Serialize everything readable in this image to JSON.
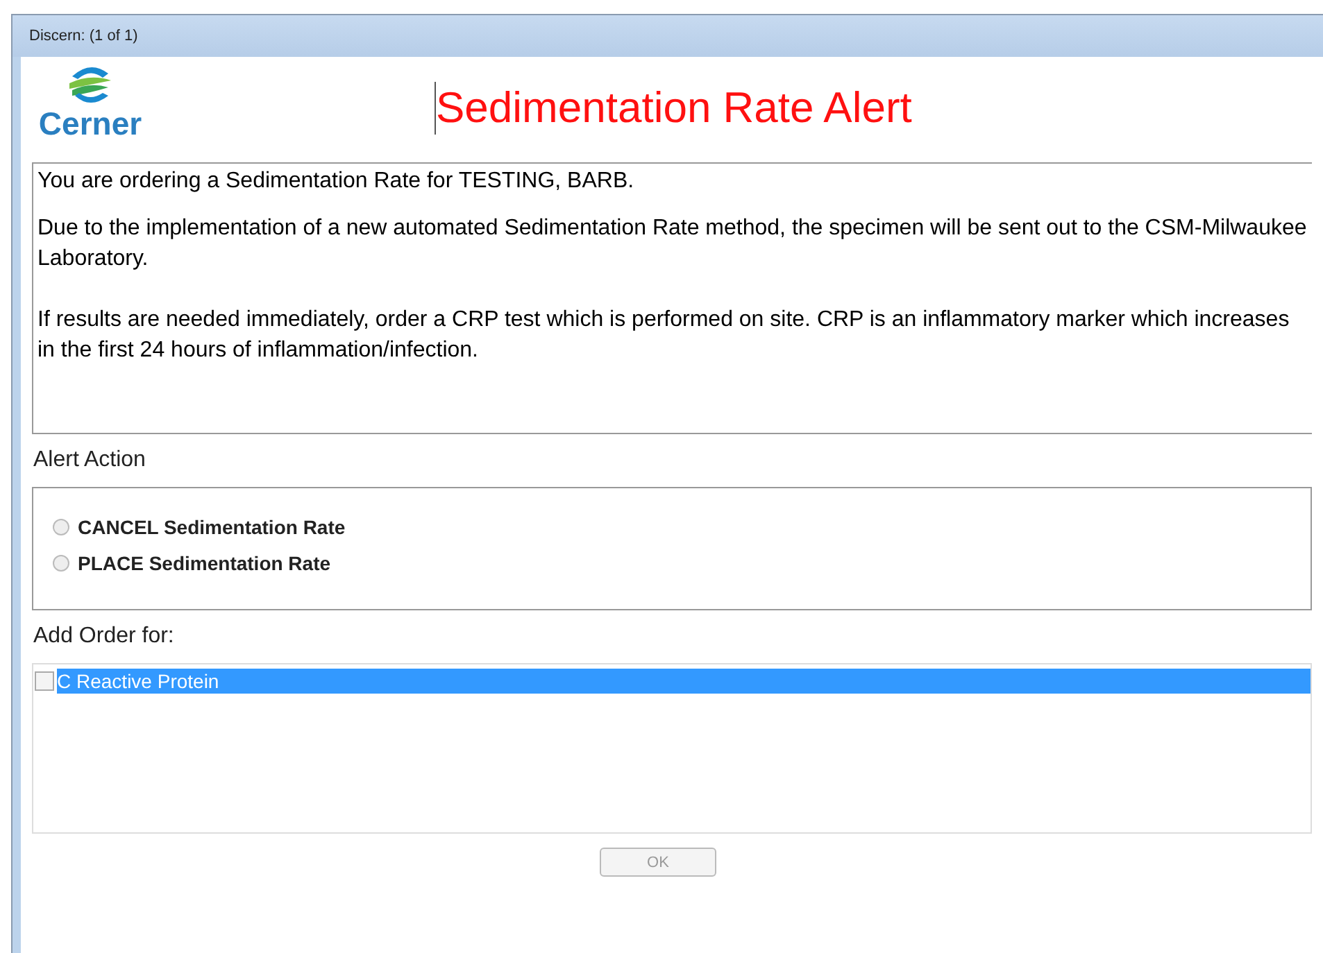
{
  "window": {
    "title": "Discern: (1 of 1)"
  },
  "logo": {
    "text": "Cerner"
  },
  "heading": "Sedimentation Rate Alert",
  "message": [
    "You are ordering a Sedimentation Rate for TESTING, BARB.",
    "Due to the implementation of a new automated Sedimentation Rate method, the specimen will be sent out to the CSM-Milwaukee Laboratory.",
    "If results are needed immediately, order a CRP test which is performed on site. CRP is an inflammatory marker which increases in the first 24 hours of inflammation/infection."
  ],
  "alert_action": {
    "label": "Alert Action",
    "options": [
      {
        "label": "CANCEL Sedimentation Rate",
        "selected": false
      },
      {
        "label": "PLACE Sedimentation Rate",
        "selected": false
      }
    ]
  },
  "add_order": {
    "label": "Add Order for:",
    "items": [
      {
        "label": "C Reactive Protein",
        "checked": false,
        "selected": true
      }
    ]
  },
  "ok_button": {
    "label": "OK",
    "disabled": true
  }
}
